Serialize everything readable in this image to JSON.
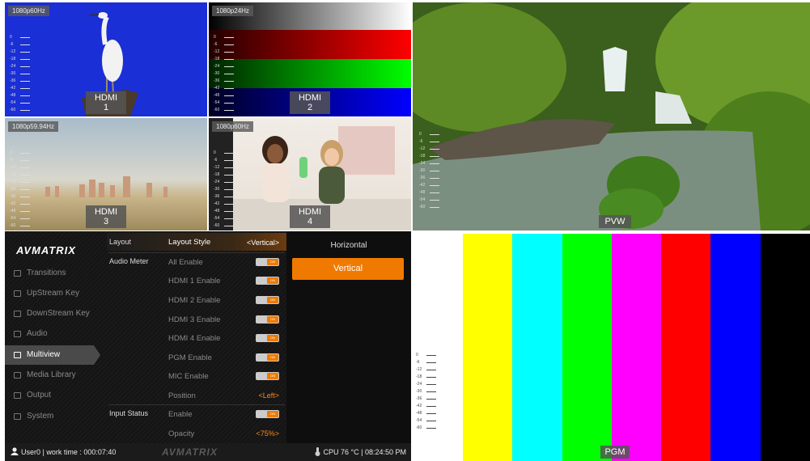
{
  "multiview": {
    "hdmi1": {
      "format": "1080p60Hz",
      "label": "HDMI 1"
    },
    "hdmi2": {
      "format": "1080p24Hz",
      "label": "HDMI 2"
    },
    "hdmi3": {
      "format": "1080p59.94Hz",
      "label": "HDMI 3"
    },
    "hdmi4": {
      "format": "1080p60Hz",
      "label": "HDMI 4"
    },
    "pvw": {
      "label": "PVW"
    },
    "pgm": {
      "label": "PGM"
    },
    "meter_ticks": [
      "0",
      "-6",
      "-12",
      "-18",
      "-24",
      "-30",
      "-36",
      "-42",
      "-48",
      "-54",
      "-60"
    ]
  },
  "menu": {
    "logo": "AVMATRIX",
    "nav": [
      {
        "label": "Transitions",
        "icon": "transitions-icon"
      },
      {
        "label": "UpStream Key",
        "icon": "upstream-key-icon"
      },
      {
        "label": "DownStream Key",
        "icon": "downstream-key-icon"
      },
      {
        "label": "Audio",
        "icon": "audio-icon"
      },
      {
        "label": "Multiview",
        "icon": "multiview-icon"
      },
      {
        "label": "Media Library",
        "icon": "media-library-icon"
      },
      {
        "label": "Output",
        "icon": "output-icon"
      },
      {
        "label": "System",
        "icon": "system-icon"
      }
    ],
    "active_nav": "Multiview",
    "sections": {
      "layout": "Layout",
      "audio_meter": "Audio Meter",
      "input_status": "Input Status"
    },
    "options": {
      "layout_style": {
        "label": "Layout Style",
        "value": "<Vertical>"
      },
      "all_enable": {
        "label": "All Enable",
        "on": true
      },
      "hdmi1_enable": {
        "label": "HDMI 1 Enable",
        "on": true
      },
      "hdmi2_enable": {
        "label": "HDMI 2 Enable",
        "on": true
      },
      "hdmi3_enable": {
        "label": "HDMI 3 Enable",
        "on": true
      },
      "hdmi4_enable": {
        "label": "HDMI 4 Enable",
        "on": true
      },
      "pgm_enable": {
        "label": "PGM Enable",
        "on": true
      },
      "mic_enable": {
        "label": "MIC Enable",
        "on": true
      },
      "position": {
        "label": "Position",
        "value": "<Left>"
      },
      "input_enable": {
        "label": "Enable",
        "on": true
      },
      "opacity": {
        "label": "Opacity",
        "value": "<75%>"
      }
    },
    "toggle_text": "ON",
    "choices": {
      "horizontal": "Horizontal",
      "vertical": "Vertical",
      "selected": "Vertical"
    }
  },
  "statusbar": {
    "user": "User0 | work time : 000:07:40",
    "brand": "AVMATRIX",
    "cpu": "CPU 76 °C | 08:24:50 PM"
  },
  "colors": {
    "accent": "#f07a00",
    "color_bars": [
      "#ffffff",
      "#ffff00",
      "#00ffff",
      "#00ff00",
      "#ff00ff",
      "#ff0000",
      "#0000ff",
      "#000000"
    ]
  }
}
